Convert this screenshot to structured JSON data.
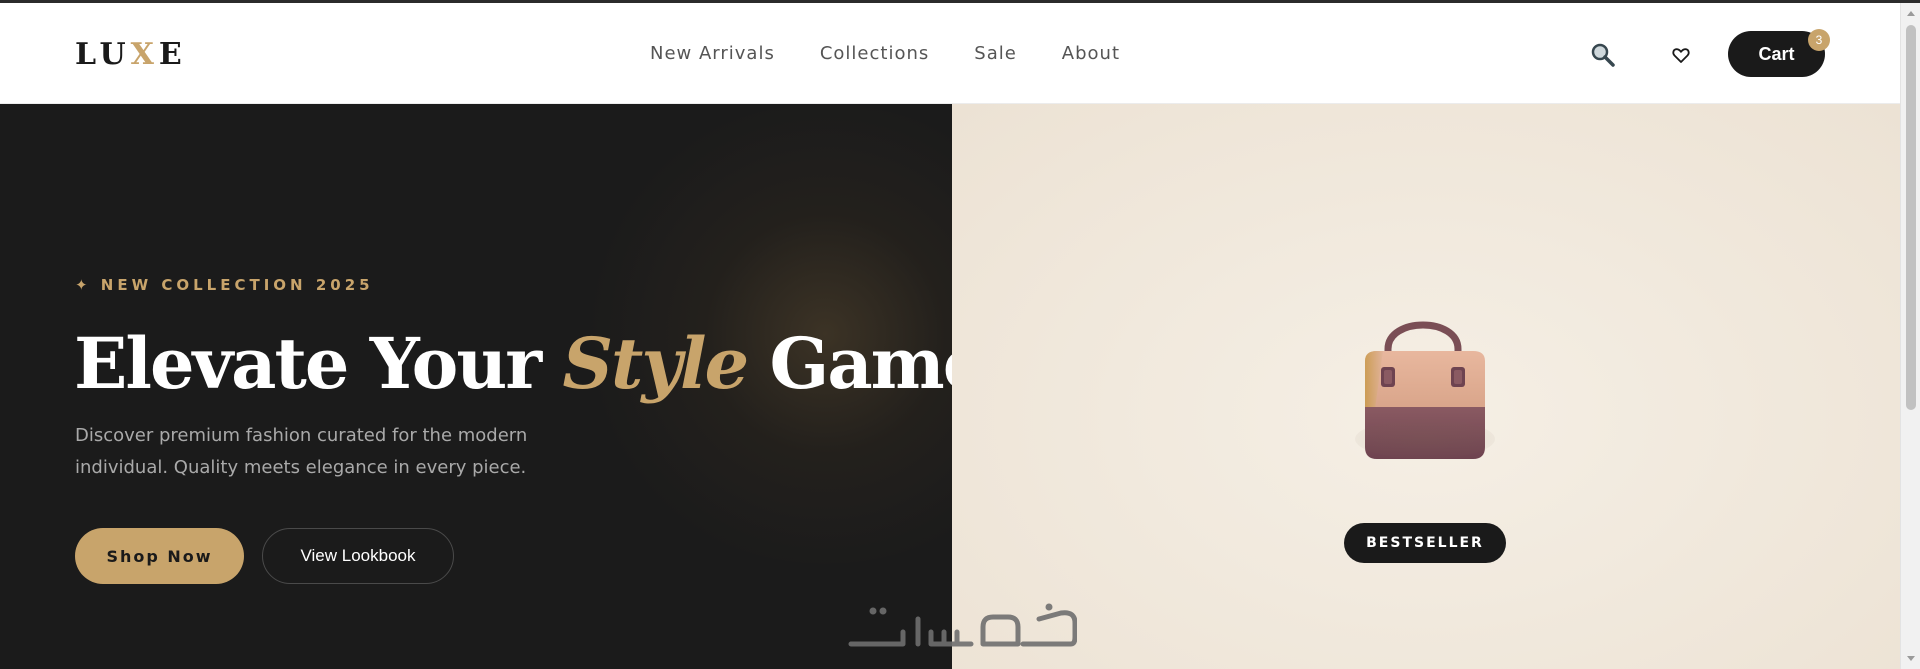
{
  "brand": {
    "logo_start": "LU",
    "logo_accent": "X",
    "logo_end": "E",
    "accent_color": "#c8a46b",
    "dark_color": "#1b1b1b"
  },
  "nav": {
    "items": [
      {
        "label": "New Arrivals"
      },
      {
        "label": "Collections"
      },
      {
        "label": "Sale"
      },
      {
        "label": "About"
      }
    ]
  },
  "header_actions": {
    "search_icon": "search-icon",
    "wishlist_icon": "heart-icon",
    "cart_label": "Cart",
    "cart_count": "3"
  },
  "hero": {
    "eyebrow": "✦ NEW COLLECTION 2025",
    "headline_start": "Elevate Your ",
    "headline_accent": "Style",
    "headline_end": " Game",
    "subtext": "Discover premium fashion curated for the modern individual. Quality meets elegance in every piece.",
    "primary_button": "Shop Now",
    "secondary_button": "View Lookbook"
  },
  "feature": {
    "product_icon": "handbag-icon",
    "badge": "BESTSELLER"
  },
  "watermark": {
    "text": "خمسات"
  }
}
